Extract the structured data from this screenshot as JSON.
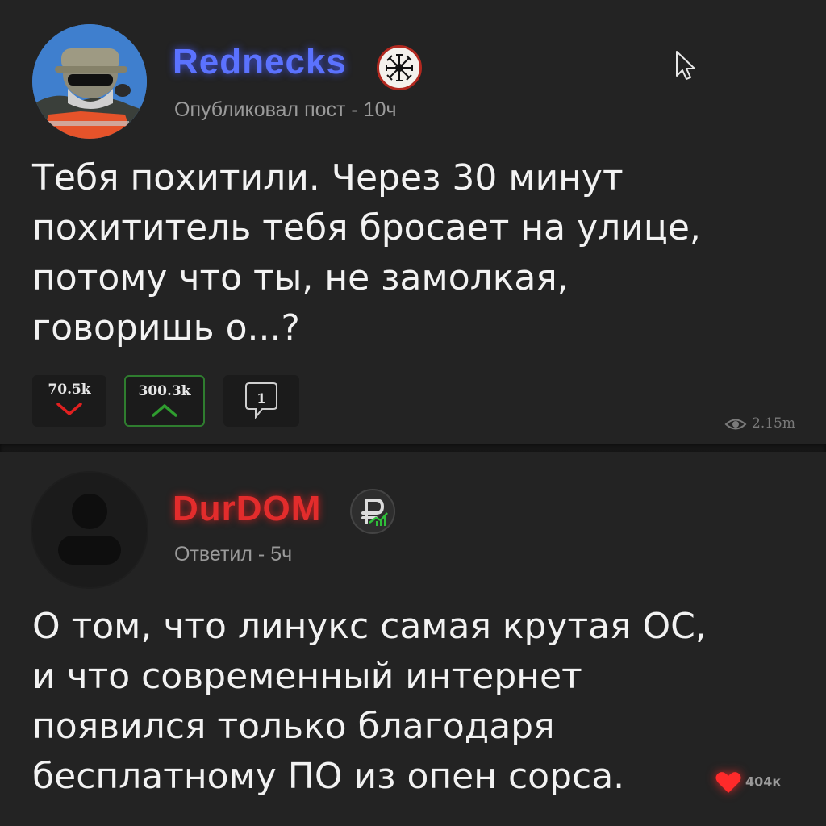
{
  "post": {
    "username": "Rednecks",
    "meta": "Опубликовал пост - 10ч",
    "text": "Тебя похитили. Через 30 минут\nпохититель тебя бросает на улице,\nпотому что ты, не замолкая,\nговоришь о...?",
    "downvotes": "70.5k",
    "upvotes": "300.3k",
    "comments": "1",
    "views": "2.15m",
    "avatar_icon": "user-photo-avatar",
    "badge_icon": "aegishjalmur-rune-badge-icon"
  },
  "reply": {
    "username": "DurDOM",
    "meta": "Ответил - 5ч",
    "text": "О том, что линукс самая крутая ОС,\nи что современный интернет\nпоявился только благодаря\nбесплатному ПО из опен сорса.",
    "likes": "404к",
    "avatar_icon": "default-user-avatar-icon",
    "badge_icon": "ruble-chart-badge-icon"
  },
  "colors": {
    "background": "#232323",
    "username_blue": "#5b72ff",
    "username_red": "#e22c2c",
    "upvote_green": "#2f9d2f",
    "downvote_red": "#e02020",
    "like_red": "#ff2a2a"
  }
}
